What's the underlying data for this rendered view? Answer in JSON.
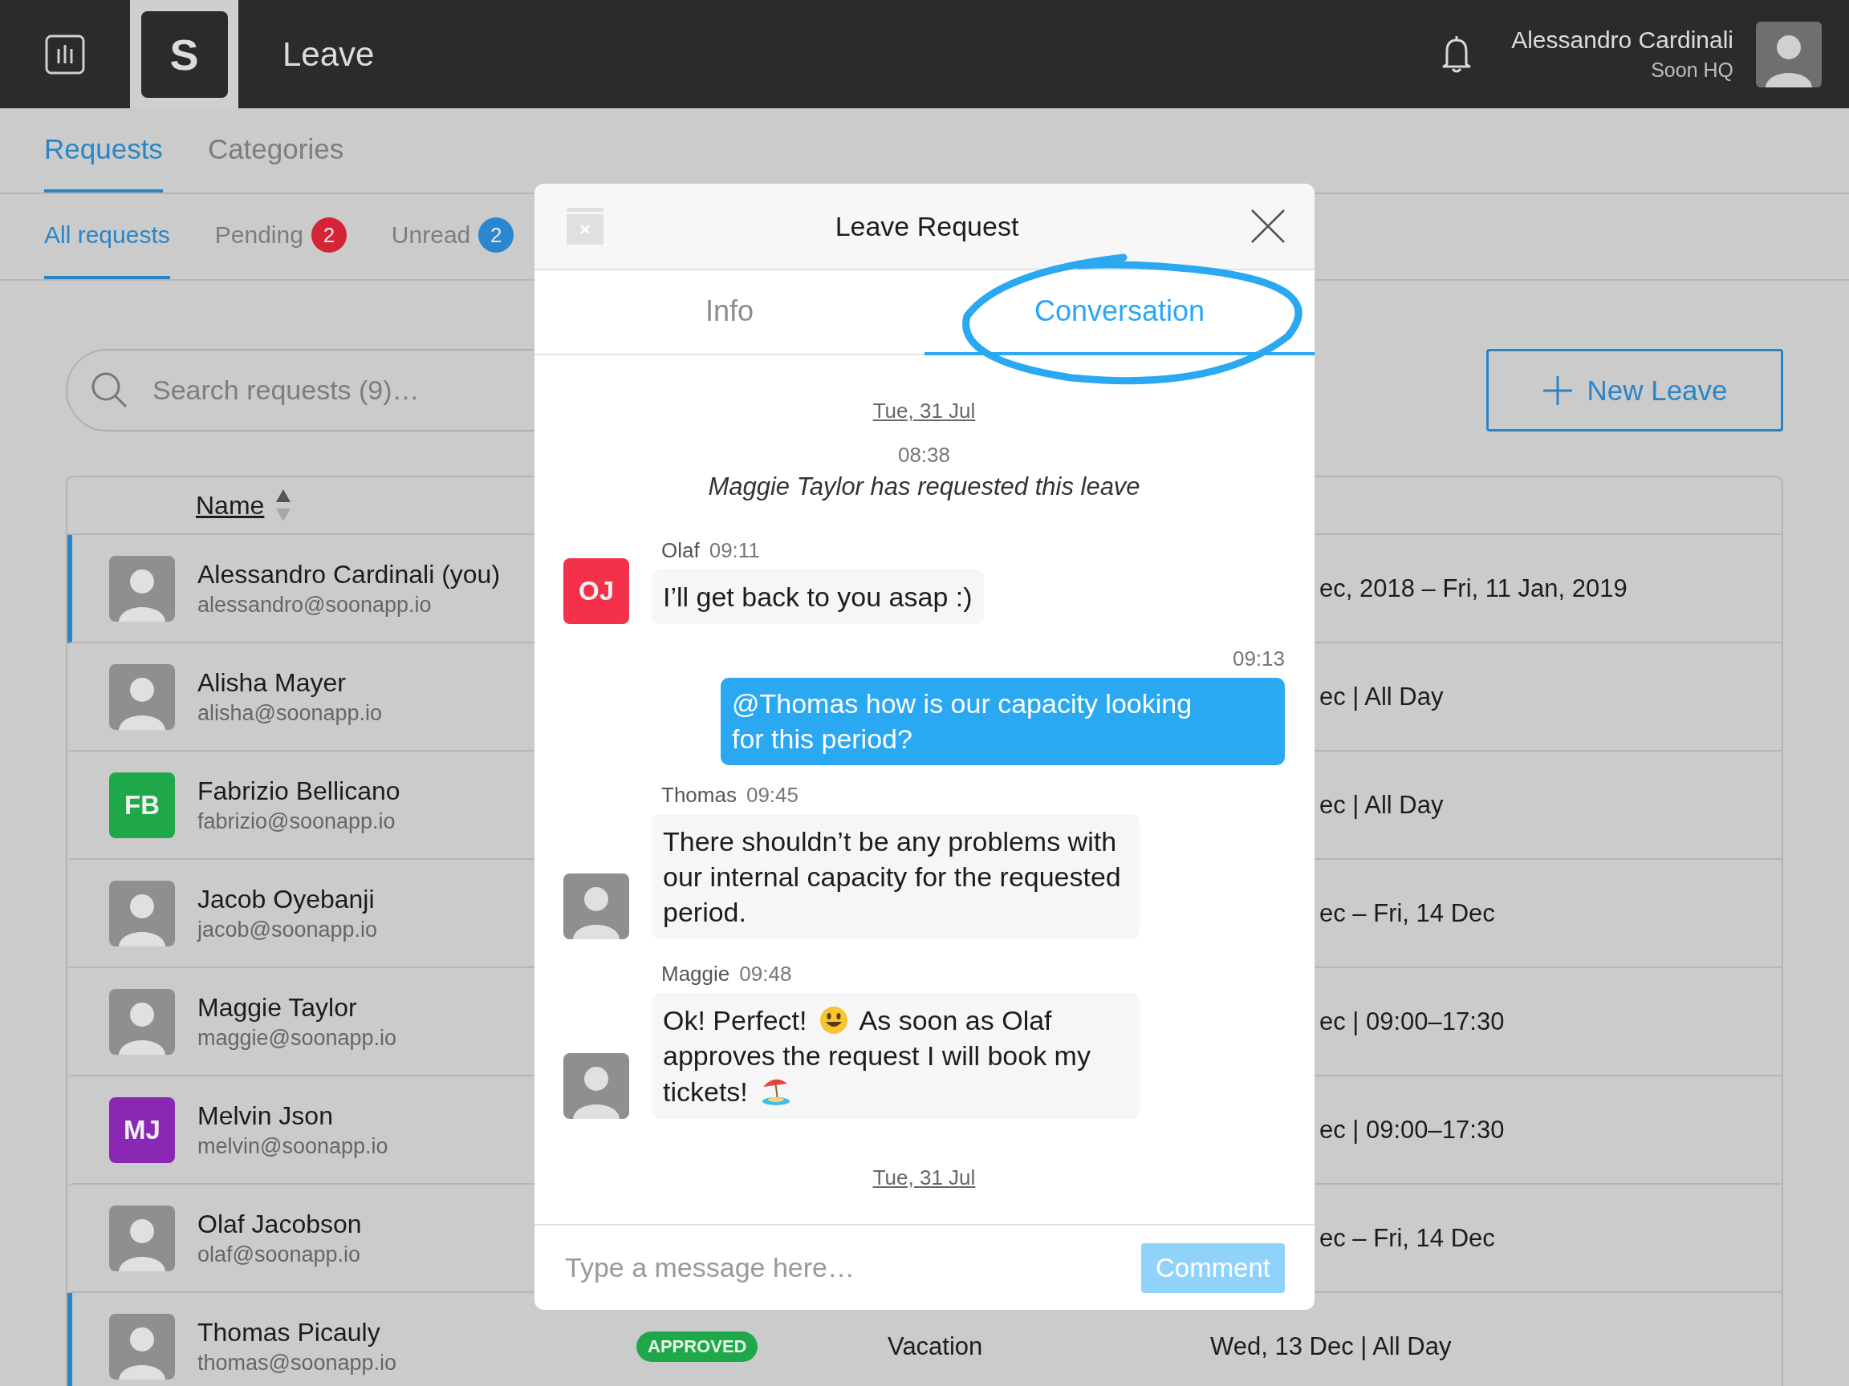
{
  "app": {
    "logo": "S",
    "title": "Leave"
  },
  "user": {
    "name": "Alessandro Cardinali",
    "org": "Soon HQ"
  },
  "tabs": [
    {
      "label": "Requests",
      "selected": true
    },
    {
      "label": "Categories",
      "selected": false
    }
  ],
  "subtabs": [
    {
      "label": "All requests",
      "selected": true
    },
    {
      "label": "Pending",
      "selected": false,
      "badge": "2",
      "color": "#d52436"
    },
    {
      "label": "Unread",
      "selected": false,
      "badge": "2",
      "color": "#2a86cf"
    }
  ],
  "search": {
    "placeholder": "Search requests (9)…"
  },
  "new_button": "New Leave",
  "table": {
    "columns": [
      {
        "label": "Name",
        "sorted": true
      }
    ],
    "rows": [
      {
        "name": "Alessandro Cardinali (you)",
        "email": "alessandro@soonapp.io",
        "avatar": {
          "kind": "photo"
        },
        "highlighted": true,
        "date": "ec, 2018 – Fri, 11 Jan, 2019"
      },
      {
        "name": "Alisha Mayer",
        "email": "alisha@soonapp.io",
        "avatar": {
          "kind": "photo"
        },
        "highlighted": false,
        "date": "ec | All Day"
      },
      {
        "name": "Fabrizio Bellicano",
        "email": "fabrizio@soonapp.io",
        "avatar": {
          "kind": "initials",
          "initials": "FB",
          "color": "#1fa84a"
        },
        "highlighted": false,
        "date": "ec | All Day"
      },
      {
        "name": "Jacob Oyebanji",
        "email": "jacob@soonapp.io",
        "avatar": {
          "kind": "photo"
        },
        "highlighted": false,
        "date": "ec – Fri, 14 Dec"
      },
      {
        "name": "Maggie Taylor",
        "email": "maggie@soonapp.io",
        "avatar": {
          "kind": "photo"
        },
        "highlighted": false,
        "date": "ec | 09:00–17:30"
      },
      {
        "name": "Melvin Json",
        "email": "melvin@soonapp.io",
        "avatar": {
          "kind": "initials",
          "initials": "MJ",
          "color": "#8a27b3"
        },
        "highlighted": false,
        "date": "ec | 09:00–17:30"
      },
      {
        "name": "Olaf Jacobson",
        "email": "olaf@soonapp.io",
        "avatar": {
          "kind": "photo"
        },
        "highlighted": false,
        "date": "ec – Fri, 14 Dec"
      },
      {
        "name": "Thomas Picauly",
        "email": "thomas@soonapp.io",
        "avatar": {
          "kind": "photo"
        },
        "highlighted": true,
        "status": "APPROVED",
        "type": "Vacation",
        "date": "Wed, 13 Dec | All Day"
      }
    ]
  },
  "modal": {
    "title": "Leave Request",
    "tabs": [
      {
        "label": "Info",
        "selected": false
      },
      {
        "label": "Conversation",
        "selected": true
      }
    ],
    "messages": [
      {
        "kind": "date",
        "text": "Tue, 31 Jul"
      },
      {
        "kind": "system",
        "time": "08:38",
        "text": "Maggie Taylor has requested this leave"
      },
      {
        "kind": "incoming",
        "author": "Olaf",
        "time": "09:11",
        "avatar": {
          "kind": "initials",
          "initials": "OJ",
          "color": "#f5304a"
        },
        "parts": [
          {
            "kind": "text",
            "text": "I’ll get back to you asap :)"
          }
        ]
      },
      {
        "kind": "outgoing",
        "time": "09:13",
        "parts": [
          {
            "kind": "text",
            "text": "@Thomas how is our capacity looking for this period?"
          }
        ]
      },
      {
        "kind": "incoming",
        "author": "Thomas",
        "time": "09:45",
        "avatar": {
          "kind": "photo"
        },
        "parts": [
          {
            "kind": "text",
            "text": "There shouldn’t be any problems with our internal capacity for the requested period."
          }
        ]
      },
      {
        "kind": "incoming",
        "author": "Maggie",
        "time": "09:48",
        "avatar": {
          "kind": "photo"
        },
        "parts": [
          {
            "kind": "text",
            "text": "Ok! Perfect!"
          },
          {
            "kind": "smiley"
          },
          {
            "kind": "text",
            "text": "As soon as Olaf approves the request I will book my tickets!"
          },
          {
            "kind": "umbrella"
          }
        ]
      },
      {
        "kind": "date",
        "text": "Tue, 31 Jul"
      }
    ],
    "input": {
      "placeholder": "Type a message here…"
    },
    "submit": {
      "label": "Comment",
      "disabled": true
    }
  }
}
